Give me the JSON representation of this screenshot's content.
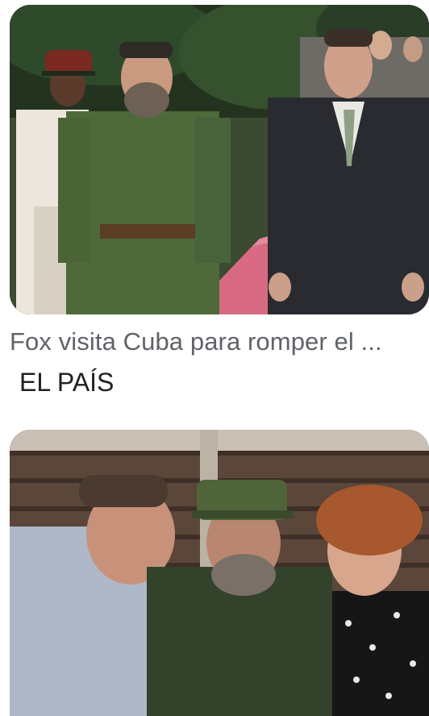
{
  "results": [
    {
      "image": {
        "kind": "photo",
        "alt": ""
      },
      "title": "Fox visita Cuba para romper el ...",
      "source": "EL PAÍS"
    },
    {
      "image": {
        "kind": "photo",
        "alt": ""
      }
    }
  ],
  "colors": {
    "title": "#5f6368",
    "source": "#202124",
    "background": "#ffffff"
  }
}
